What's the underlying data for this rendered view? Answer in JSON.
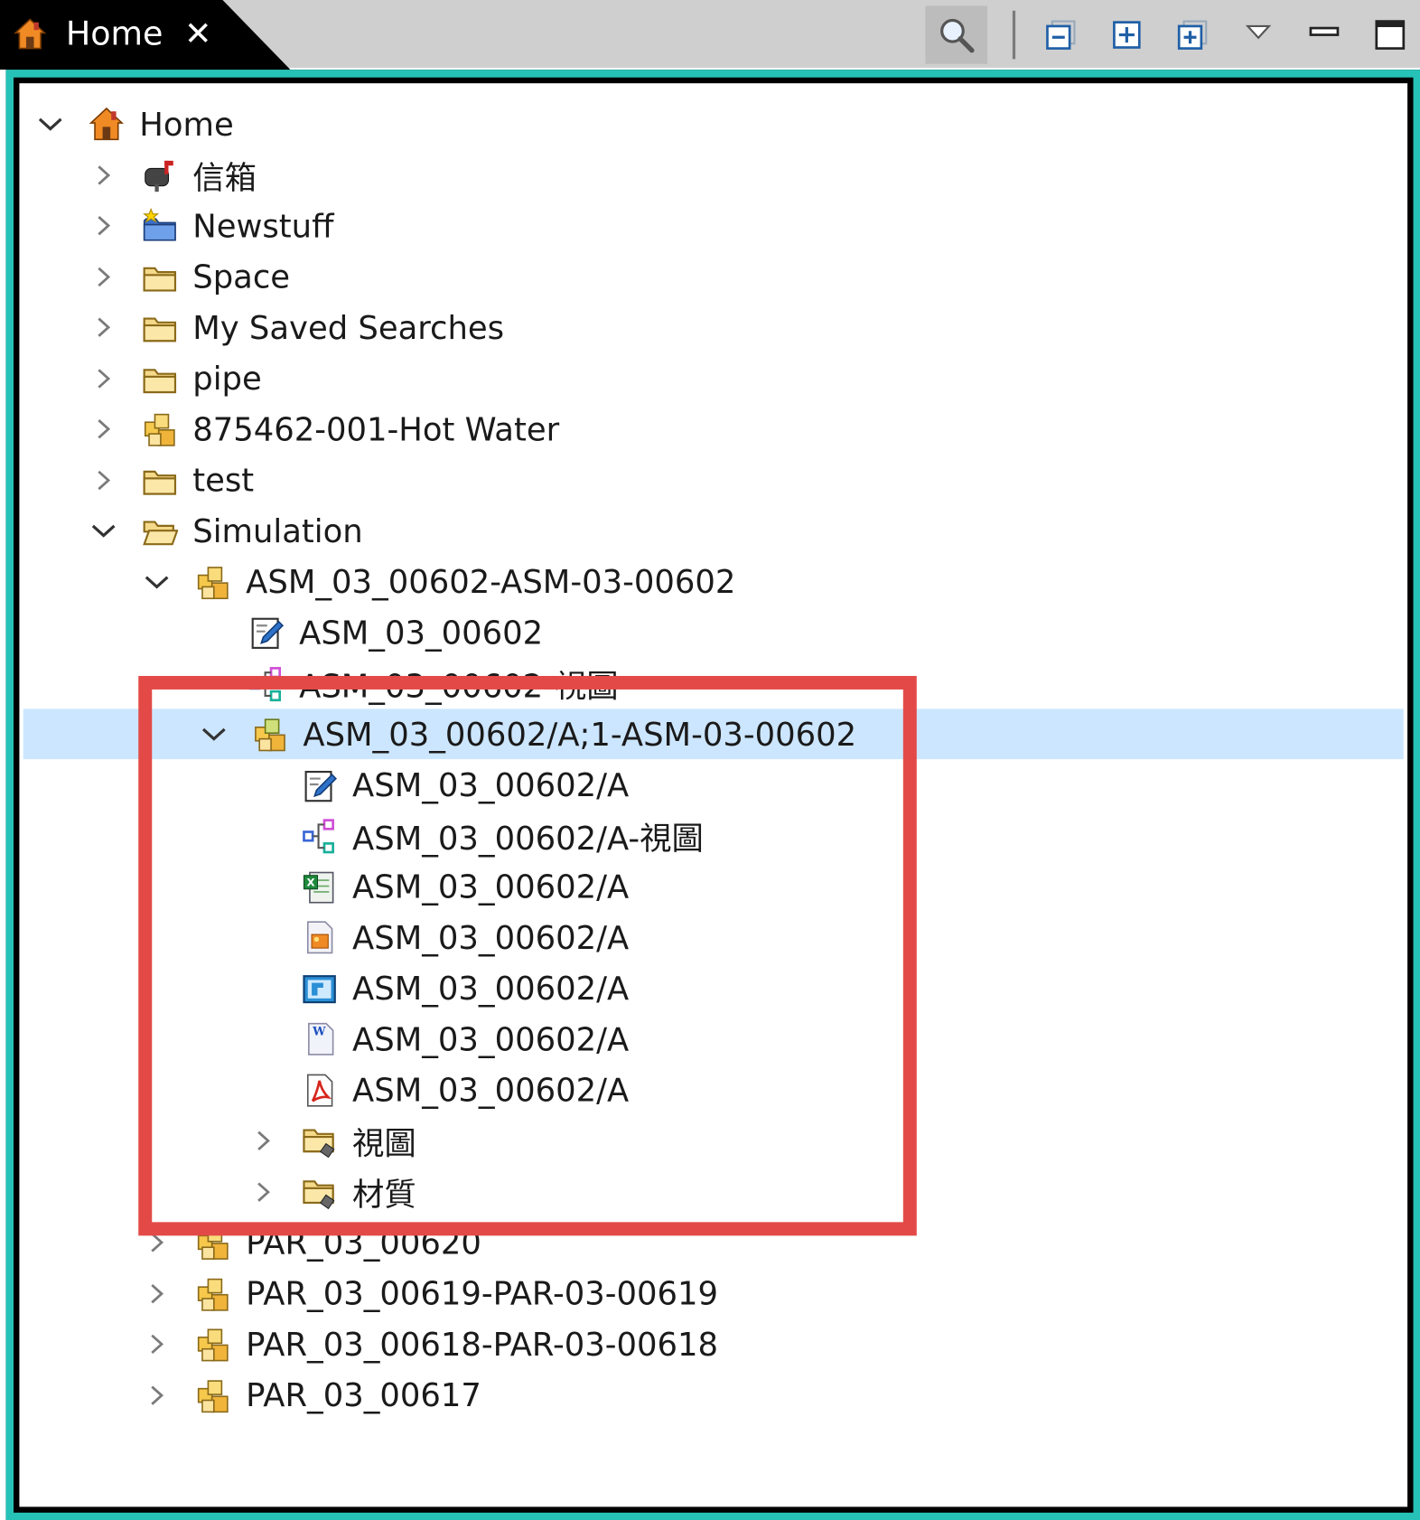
{
  "tab": {
    "title": "Home",
    "close_symbol": "✕"
  },
  "toolbar": {
    "search": "search-icon",
    "collapse": "collapse-all-icon",
    "expand": "expand-icon",
    "expand_all": "expand-all-icon",
    "menu": "view-menu-icon",
    "minimize": "minimize-icon",
    "maximize": "maximize-icon"
  },
  "colors": {
    "frame": "#26c2b8",
    "selection": "#cce6ff",
    "highlight": "#e34a47"
  },
  "tree": [
    {
      "label": "Home",
      "level": 0,
      "expander": "expanded",
      "icon": "home-icon"
    },
    {
      "label": "信箱",
      "level": 1,
      "expander": "collapsed",
      "icon": "mailbox-icon"
    },
    {
      "label": "Newstuff",
      "level": 1,
      "expander": "collapsed",
      "icon": "newstuff-folder-icon"
    },
    {
      "label": "Space",
      "level": 1,
      "expander": "collapsed",
      "icon": "folder-icon"
    },
    {
      "label": "My Saved Searches",
      "level": 1,
      "expander": "collapsed",
      "icon": "folder-icon"
    },
    {
      "label": "pipe",
      "level": 1,
      "expander": "collapsed",
      "icon": "folder-icon"
    },
    {
      "label": "875462-001-Hot Water",
      "level": 1,
      "expander": "collapsed",
      "icon": "item-icon"
    },
    {
      "label": "test",
      "level": 1,
      "expander": "collapsed",
      "icon": "folder-icon"
    },
    {
      "label": "Simulation",
      "level": 1,
      "expander": "expanded",
      "icon": "folder-open-icon"
    },
    {
      "label": "ASM_03_00602-ASM-03-00602",
      "level": 2,
      "expander": "expanded",
      "icon": "item-icon"
    },
    {
      "label": "ASM_03_00602",
      "level": 3,
      "expander": "none",
      "icon": "form-icon"
    },
    {
      "label": "ASM_03_00602-視圖",
      "level": 3,
      "expander": "none",
      "icon": "bom-view-icon"
    },
    {
      "label": "ASM_03_00602/A;1-ASM-03-00602",
      "level": 3,
      "expander": "expanded",
      "icon": "item-revision-icon",
      "selected": true
    },
    {
      "label": "ASM_03_00602/A",
      "level": 4,
      "expander": "none",
      "icon": "form-icon"
    },
    {
      "label": "ASM_03_00602/A-視圖",
      "level": 4,
      "expander": "none",
      "icon": "bom-view-icon"
    },
    {
      "label": "ASM_03_00602/A",
      "level": 4,
      "expander": "none",
      "icon": "excel-icon"
    },
    {
      "label": "ASM_03_00602/A",
      "level": 4,
      "expander": "none",
      "icon": "image-icon"
    },
    {
      "label": "ASM_03_00602/A",
      "level": 4,
      "expander": "none",
      "icon": "cad-icon"
    },
    {
      "label": "ASM_03_00602/A",
      "level": 4,
      "expander": "none",
      "icon": "word-icon"
    },
    {
      "label": "ASM_03_00602/A",
      "level": 4,
      "expander": "none",
      "icon": "pdf-icon"
    },
    {
      "label": "視圖",
      "level": 4,
      "expander": "collapsed",
      "icon": "pseudo-folder-icon"
    },
    {
      "label": "材質",
      "level": 4,
      "expander": "collapsed",
      "icon": "pseudo-folder-icon"
    },
    {
      "label": "PAR_03_00620",
      "level": 2,
      "expander": "collapsed",
      "icon": "item-icon"
    },
    {
      "label": "PAR_03_00619-PAR-03-00619",
      "level": 2,
      "expander": "collapsed",
      "icon": "item-icon"
    },
    {
      "label": "PAR_03_00618-PAR-03-00618",
      "level": 2,
      "expander": "collapsed",
      "icon": "item-icon"
    },
    {
      "label": "PAR_03_00617",
      "level": 2,
      "expander": "collapsed",
      "icon": "item-icon"
    }
  ]
}
